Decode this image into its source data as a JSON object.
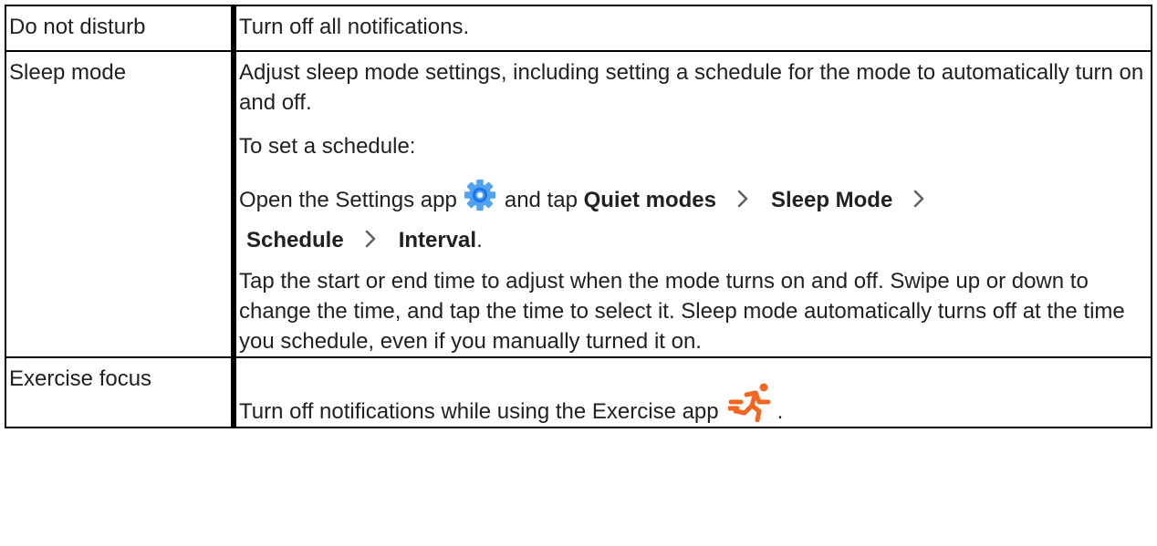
{
  "rows": [
    {
      "name": "Do not disturb",
      "desc": "Turn off all notifications."
    },
    {
      "name": "Sleep mode",
      "p1": "Adjust sleep mode settings, including setting a schedule for the mode to automatically turn on and off.",
      "p2": "To set a schedule:",
      "p3": {
        "before": "Open the Settings app",
        "mid": "and tap",
        "step1": "Quiet modes",
        "step2": "Sleep Mode",
        "step3": "Schedule",
        "step4": "Interval",
        "end": "."
      },
      "p4": "Tap the start or end time to adjust when the mode turns on and off. Swipe up or down to change the time, and tap the time to select it. Sleep mode automatically turns off at the time you schedule, even if you manually turned it on."
    },
    {
      "name": "Exercise focus",
      "desc": "Turn off notifications while using the Exercise app",
      "end": "."
    }
  ],
  "icons": {
    "settings": "settings-gear-icon",
    "exercise": "exercise-runner-icon",
    "chevron": "chevron-right-icon"
  },
  "colors": {
    "settings_icon": "#4fa3f0",
    "exercise_icon": "#f26522",
    "chevron": "#5f6368"
  }
}
